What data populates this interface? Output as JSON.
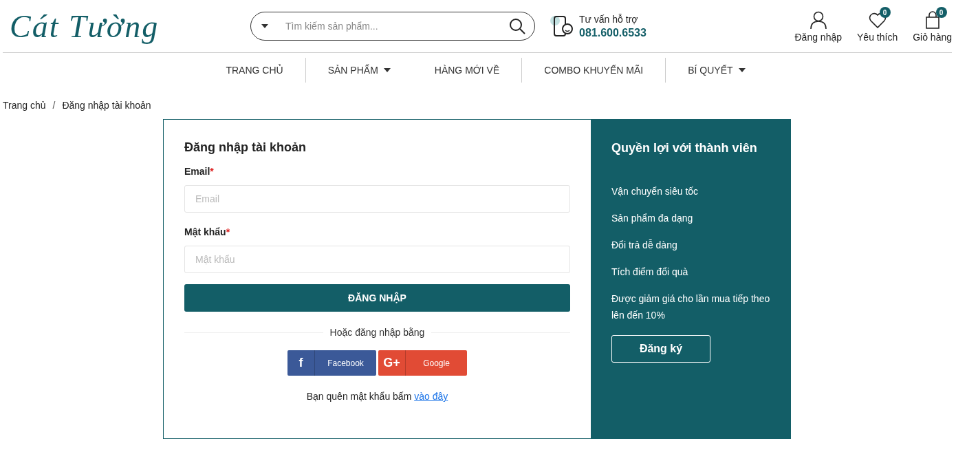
{
  "header": {
    "logo": "Cát Tường",
    "search": {
      "placeholder": "Tìm kiếm sản phẩm..."
    },
    "support": {
      "label": "Tư vấn hỗ trợ",
      "phone": "081.600.6533"
    },
    "actions": [
      {
        "kind": "user",
        "label": "Đăng nhập"
      },
      {
        "kind": "heart",
        "label": "Yêu thích",
        "count": "0"
      },
      {
        "kind": "bag",
        "label": "Giỏ hàng",
        "count": "0"
      }
    ]
  },
  "nav": [
    {
      "label": "TRANG CHỦ",
      "has_menu": false,
      "separator": true
    },
    {
      "label": "SẢN PHẨM",
      "has_menu": true,
      "separator": false
    },
    {
      "label": "HÀNG MỚI VỀ",
      "has_menu": false,
      "separator": true
    },
    {
      "label": "COMBO KHUYẾN MÃI",
      "has_menu": false,
      "separator": true
    },
    {
      "label": "BÍ QUYẾT",
      "has_menu": true,
      "separator": false
    }
  ],
  "breadcrumb": {
    "items": [
      "Trang chủ",
      "Đăng nhập tài khoản"
    ],
    "separator": "/"
  },
  "login": {
    "title": "Đăng nhập tài khoản",
    "fields": [
      {
        "label": "Email",
        "required_mark": "*",
        "placeholder": "Email"
      },
      {
        "label": "Mật khẩu",
        "required_mark": "*",
        "placeholder": "Mật khẩu"
      }
    ],
    "submit": "ĐĂNG NHẬP",
    "divider": "Hoặc đăng nhập bằng",
    "social": [
      {
        "kind": "facebook",
        "glyph": "f",
        "label": "Facebook"
      },
      {
        "kind": "google",
        "glyph": "G+",
        "label": "Google"
      }
    ],
    "forgot": {
      "text": "Bạn quên mật khẩu bấm",
      "link": "vào đây"
    }
  },
  "benefits": {
    "title": "Quyền lợi với thành viên",
    "items": [
      "Vận chuyển siêu tốc",
      "Sản phẩm đa dạng",
      "Đổi trả dễ dàng",
      "Tích điểm đổi quà",
      "Được giảm giá cho lần mua tiếp theo lên đến 10%"
    ],
    "register": "Đăng ký"
  }
}
